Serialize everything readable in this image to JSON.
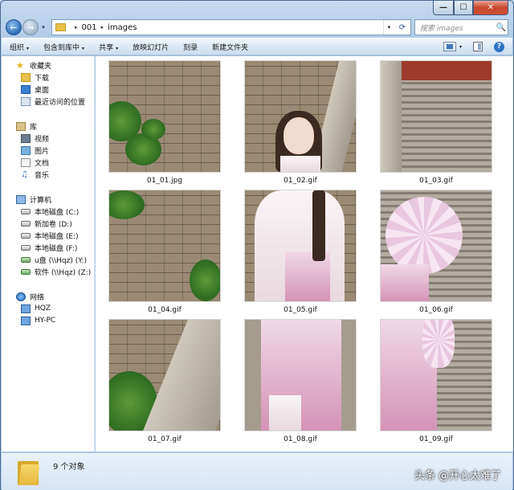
{
  "window": {
    "caption": {
      "minimize": "—",
      "maximize": "☐",
      "close": "✕"
    }
  },
  "nav": {
    "back_icon": "←",
    "forward_icon": "→",
    "drop_icon": "▾"
  },
  "address": {
    "crumbs": [
      "001",
      "images"
    ],
    "separator": "▸",
    "drop_icon": "▾",
    "refresh_icon": "⟳"
  },
  "search": {
    "placeholder": "搜索 images",
    "icon": "🔍"
  },
  "toolbar": {
    "organize": "组织",
    "include_library": "包含到库中",
    "share": "共享",
    "slideshow": "放映幻灯片",
    "burn": "刻录",
    "new_folder": "新建文件夹",
    "arrow": "▾",
    "help": "?"
  },
  "sidebar": {
    "favorites": {
      "label": "收藏夹",
      "items": [
        "下载",
        "桌面",
        "最近访问的位置"
      ]
    },
    "libraries": {
      "label": "库",
      "items": [
        "视频",
        "图片",
        "文档",
        "音乐"
      ]
    },
    "computer": {
      "label": "计算机",
      "items": [
        "本地磁盘 (C:)",
        "新加卷 (D:)",
        "本地磁盘 (E:)",
        "本地磁盘 (F:)",
        "u盘 (\\\\Hqz) (Y:)",
        "软件 (\\\\Hqz) (Z:)"
      ]
    },
    "network": {
      "label": "网络",
      "items": [
        "HQZ",
        "HY-PC"
      ]
    }
  },
  "files": [
    {
      "name": "01_01.jpg"
    },
    {
      "name": "01_02.gif"
    },
    {
      "name": "01_03.gif"
    },
    {
      "name": "01_04.gif"
    },
    {
      "name": "01_05.gif"
    },
    {
      "name": "01_06.gif"
    },
    {
      "name": "01_07.gif"
    },
    {
      "name": "01_08.gif"
    },
    {
      "name": "01_09.gif"
    }
  ],
  "status": {
    "count_text": "9 个对象"
  },
  "watermark": {
    "text": "头条 @开心太难了"
  },
  "colors": {
    "accent": "#2f74c7",
    "close_red": "#c7452b",
    "folder": "#e8c04a"
  }
}
